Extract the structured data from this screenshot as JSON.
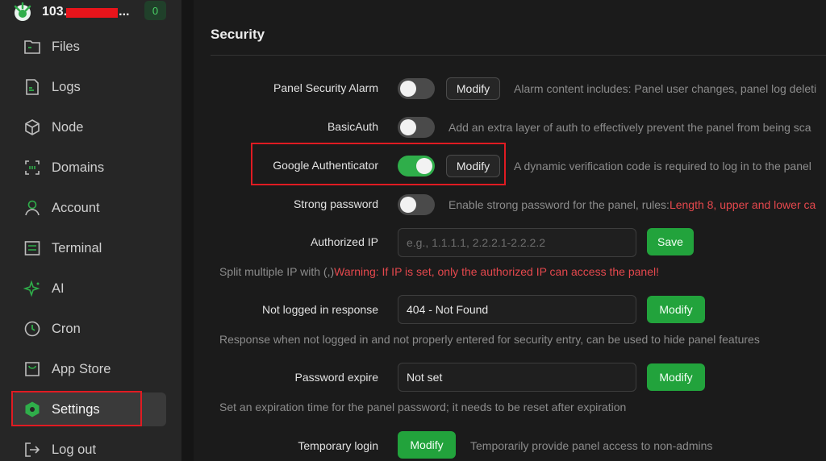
{
  "sidebar": {
    "host": "103.",
    "host_suffix": "...",
    "badge": "0",
    "items": [
      {
        "label": "Files",
        "icon": "folder-icon"
      },
      {
        "label": "Logs",
        "icon": "log-file-icon"
      },
      {
        "label": "Node",
        "icon": "cube-icon"
      },
      {
        "label": "Domains",
        "icon": "domain-icon"
      },
      {
        "label": "Account",
        "icon": "user-icon"
      },
      {
        "label": "Terminal",
        "icon": "terminal-icon"
      },
      {
        "label": "AI",
        "icon": "sparkle-icon"
      },
      {
        "label": "Cron",
        "icon": "clock-icon"
      },
      {
        "label": "App Store",
        "icon": "store-icon"
      },
      {
        "label": "Settings",
        "icon": "gear-hexagon-icon",
        "active": true
      },
      {
        "label": "Log out",
        "icon": "logout-icon"
      }
    ]
  },
  "section": {
    "title": "Security"
  },
  "rows": {
    "alarm": {
      "label": "Panel Security Alarm",
      "button": "Modify",
      "desc": "Alarm content includes: Panel user changes, panel log deleti"
    },
    "basic_auth": {
      "label": "BasicAuth",
      "desc": "Add an extra layer of auth to effectively prevent the panel from being sca"
    },
    "google_auth": {
      "label": "Google Authenticator",
      "button": "Modify",
      "desc": "A dynamic verification code is required to log in to the panel"
    },
    "strong_password": {
      "label": "Strong password",
      "desc": "Enable strong password for the panel, rules:",
      "desc_warn": "Length 8, upper and lower ca"
    },
    "authorized_ip": {
      "label": "Authorized IP",
      "placeholder": "e.g., 1.1.1.1, 2.2.2.1-2.2.2.2",
      "button": "Save",
      "help": "Split multiple IP with (,)",
      "help_warn": "Warning: If IP is set, only the authorized IP can access the panel!"
    },
    "not_logged_response": {
      "label": "Not logged in response",
      "value": "404 - Not Found",
      "button": "Modify",
      "help": "Response when not logged in and not properly entered for security entry, can be used to hide panel features"
    },
    "password_expire": {
      "label": "Password expire",
      "value": "Not set",
      "button": "Modify",
      "help": "Set an expiration time for the panel password; it needs to be reset after expiration"
    },
    "temporary_login": {
      "label": "Temporary login",
      "button": "Modify",
      "desc": "Temporarily provide panel access to non-admins"
    }
  },
  "toggles": {
    "alarm": false,
    "basic_auth": false,
    "google_auth": true,
    "strong_password": false
  },
  "colors": {
    "accent": "#22a33c",
    "warning": "#e5484d",
    "highlight": "#e01b22"
  }
}
